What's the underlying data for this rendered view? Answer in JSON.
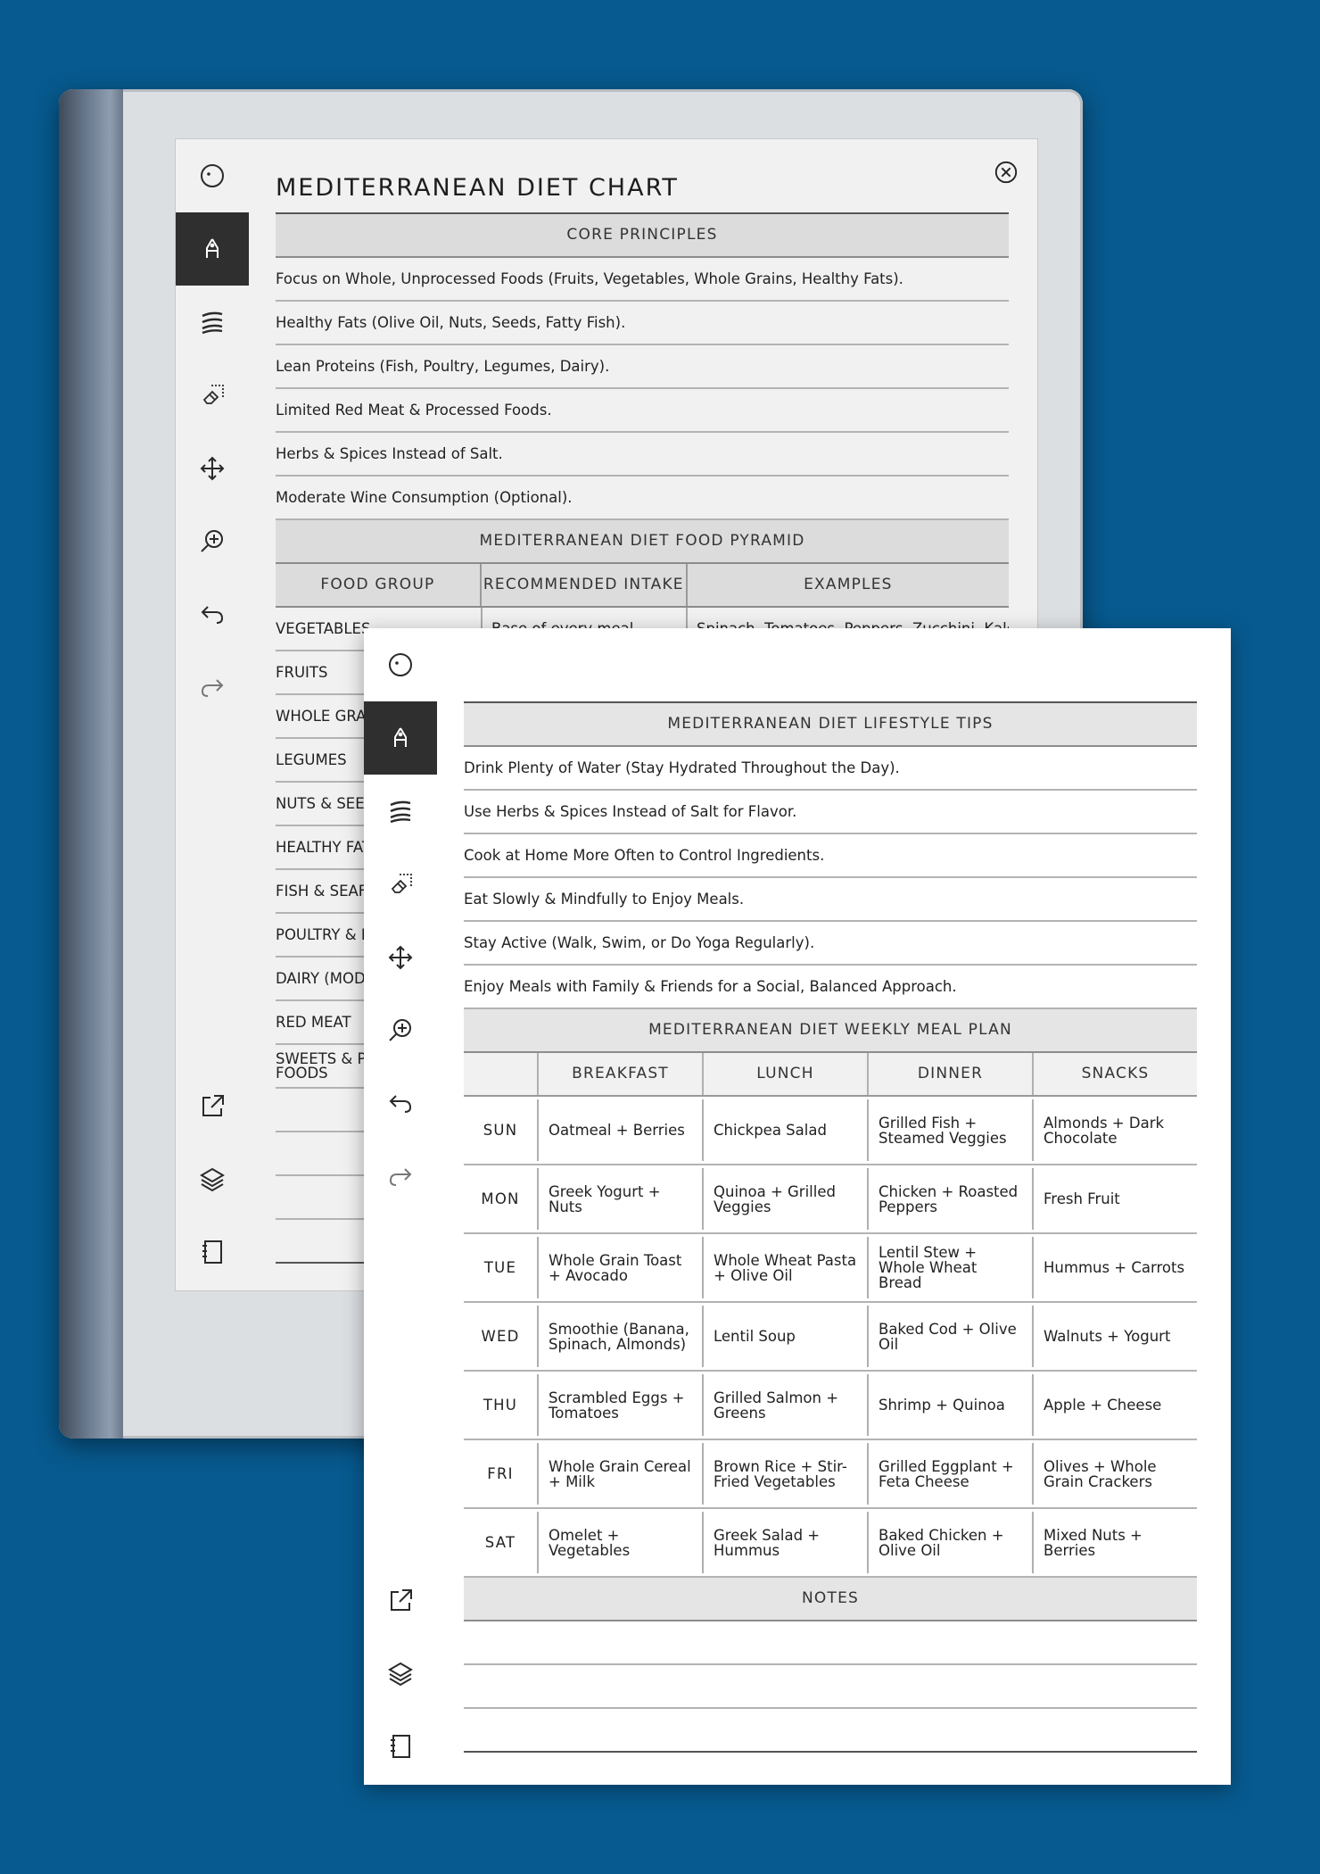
{
  "toolbar": {
    "items": [
      "menu-icon",
      "pen-icon",
      "brush-icon",
      "eraser-icon",
      "move-icon",
      "zoom-icon",
      "undo-icon",
      "redo-icon",
      "export-icon",
      "layers-icon",
      "notebook-icon"
    ]
  },
  "page1": {
    "title": "MEDITERRANEAN DIET CHART",
    "core_head": "CORE PRINCIPLES",
    "principles": [
      "Focus on Whole, Unprocessed Foods (Fruits, Vegetables, Whole Grains, Healthy Fats).",
      "Healthy Fats (Olive Oil, Nuts, Seeds, Fatty Fish).",
      "Lean Proteins (Fish, Poultry, Legumes, Dairy).",
      "Limited Red Meat & Processed Foods.",
      "Herbs & Spices Instead of Salt.",
      "Moderate Wine Consumption (Optional)."
    ],
    "pyramid_head": "MEDITERRANEAN DIET FOOD PYRAMID",
    "pyramid_columns": [
      "FOOD GROUP",
      "RECOMMENDED INTAKE",
      "EXAMPLES"
    ],
    "pyramid_rows": [
      {
        "group": "VEGETABLES",
        "intake": "Base of every meal",
        "examples": "Spinach, Tomatoes, Peppers, Zucchini, Kale"
      },
      {
        "group": "FRUITS",
        "intake": "",
        "examples": ""
      },
      {
        "group": "WHOLE GRAI",
        "intake": "",
        "examples": ""
      },
      {
        "group": "LEGUMES",
        "intake": "",
        "examples": ""
      },
      {
        "group": "NUTS & SEED",
        "intake": "",
        "examples": ""
      },
      {
        "group": "HEALTHY FAT",
        "intake": "",
        "examples": ""
      },
      {
        "group": "FISH & SEAFO",
        "intake": "",
        "examples": ""
      },
      {
        "group": "POULTRY & E",
        "intake": "",
        "examples": ""
      },
      {
        "group": "DAIRY (MODE",
        "intake": "",
        "examples": ""
      },
      {
        "group": "RED MEAT",
        "intake": "",
        "examples": ""
      },
      {
        "group": "SWEETS & PR\nFOODS",
        "intake": "",
        "examples": ""
      }
    ]
  },
  "page2": {
    "tips_head": "MEDITERRANEAN DIET LIFESTYLE TIPS",
    "tips": [
      "Drink Plenty of Water (Stay Hydrated Throughout the Day).",
      "Use Herbs & Spices Instead of Salt for Flavor.",
      "Cook at Home More Often to Control Ingredients.",
      "Eat Slowly & Mindfully to Enjoy Meals.",
      "Stay Active (Walk, Swim, or Do Yoga Regularly).",
      "Enjoy Meals with Family & Friends for a Social, Balanced Approach."
    ],
    "meal_head": "MEDITERRANEAN DIET WEEKLY MEAL PLAN",
    "meal_columns": [
      "",
      "BREAKFAST",
      "LUNCH",
      "DINNER",
      "SNACKS"
    ],
    "meals": [
      {
        "day": "SUN",
        "breakfast": "Oatmeal + Berries",
        "lunch": "Chickpea Salad",
        "dinner": "Grilled Fish + Steamed Veggies",
        "snacks": "Almonds + Dark Chocolate"
      },
      {
        "day": "MON",
        "breakfast": "Greek Yogurt + Nuts",
        "lunch": "Quinoa + Grilled Veggies",
        "dinner": "Chicken + Roasted Peppers",
        "snacks": "Fresh Fruit"
      },
      {
        "day": "TUE",
        "breakfast": "Whole Grain Toast + Avocado",
        "lunch": "Whole Wheat Pasta + Olive Oil",
        "dinner": "Lentil Stew + Whole Wheat Bread",
        "snacks": "Hummus + Carrots"
      },
      {
        "day": "WED",
        "breakfast": "Smoothie (Banana, Spinach, Almonds)",
        "lunch": "Lentil Soup",
        "dinner": "Baked Cod + Olive Oil",
        "snacks": "Walnuts + Yogurt"
      },
      {
        "day": "THU",
        "breakfast": "Scrambled Eggs + Tomatoes",
        "lunch": "Grilled Salmon + Greens",
        "dinner": "Shrimp + Quinoa",
        "snacks": "Apple + Cheese"
      },
      {
        "day": "FRI",
        "breakfast": "Whole Grain Cereal + Milk",
        "lunch": "Brown Rice + Stir-Fried Vegetables",
        "dinner": "Grilled Eggplant + Feta Cheese",
        "snacks": "Olives + Whole Grain Crackers"
      },
      {
        "day": "SAT",
        "breakfast": "Omelet + Vegetables",
        "lunch": "Greek Salad + Hummus",
        "dinner": "Baked Chicken + Olive Oil",
        "snacks": "Mixed Nuts + Berries"
      }
    ],
    "notes_head": "NOTES"
  }
}
